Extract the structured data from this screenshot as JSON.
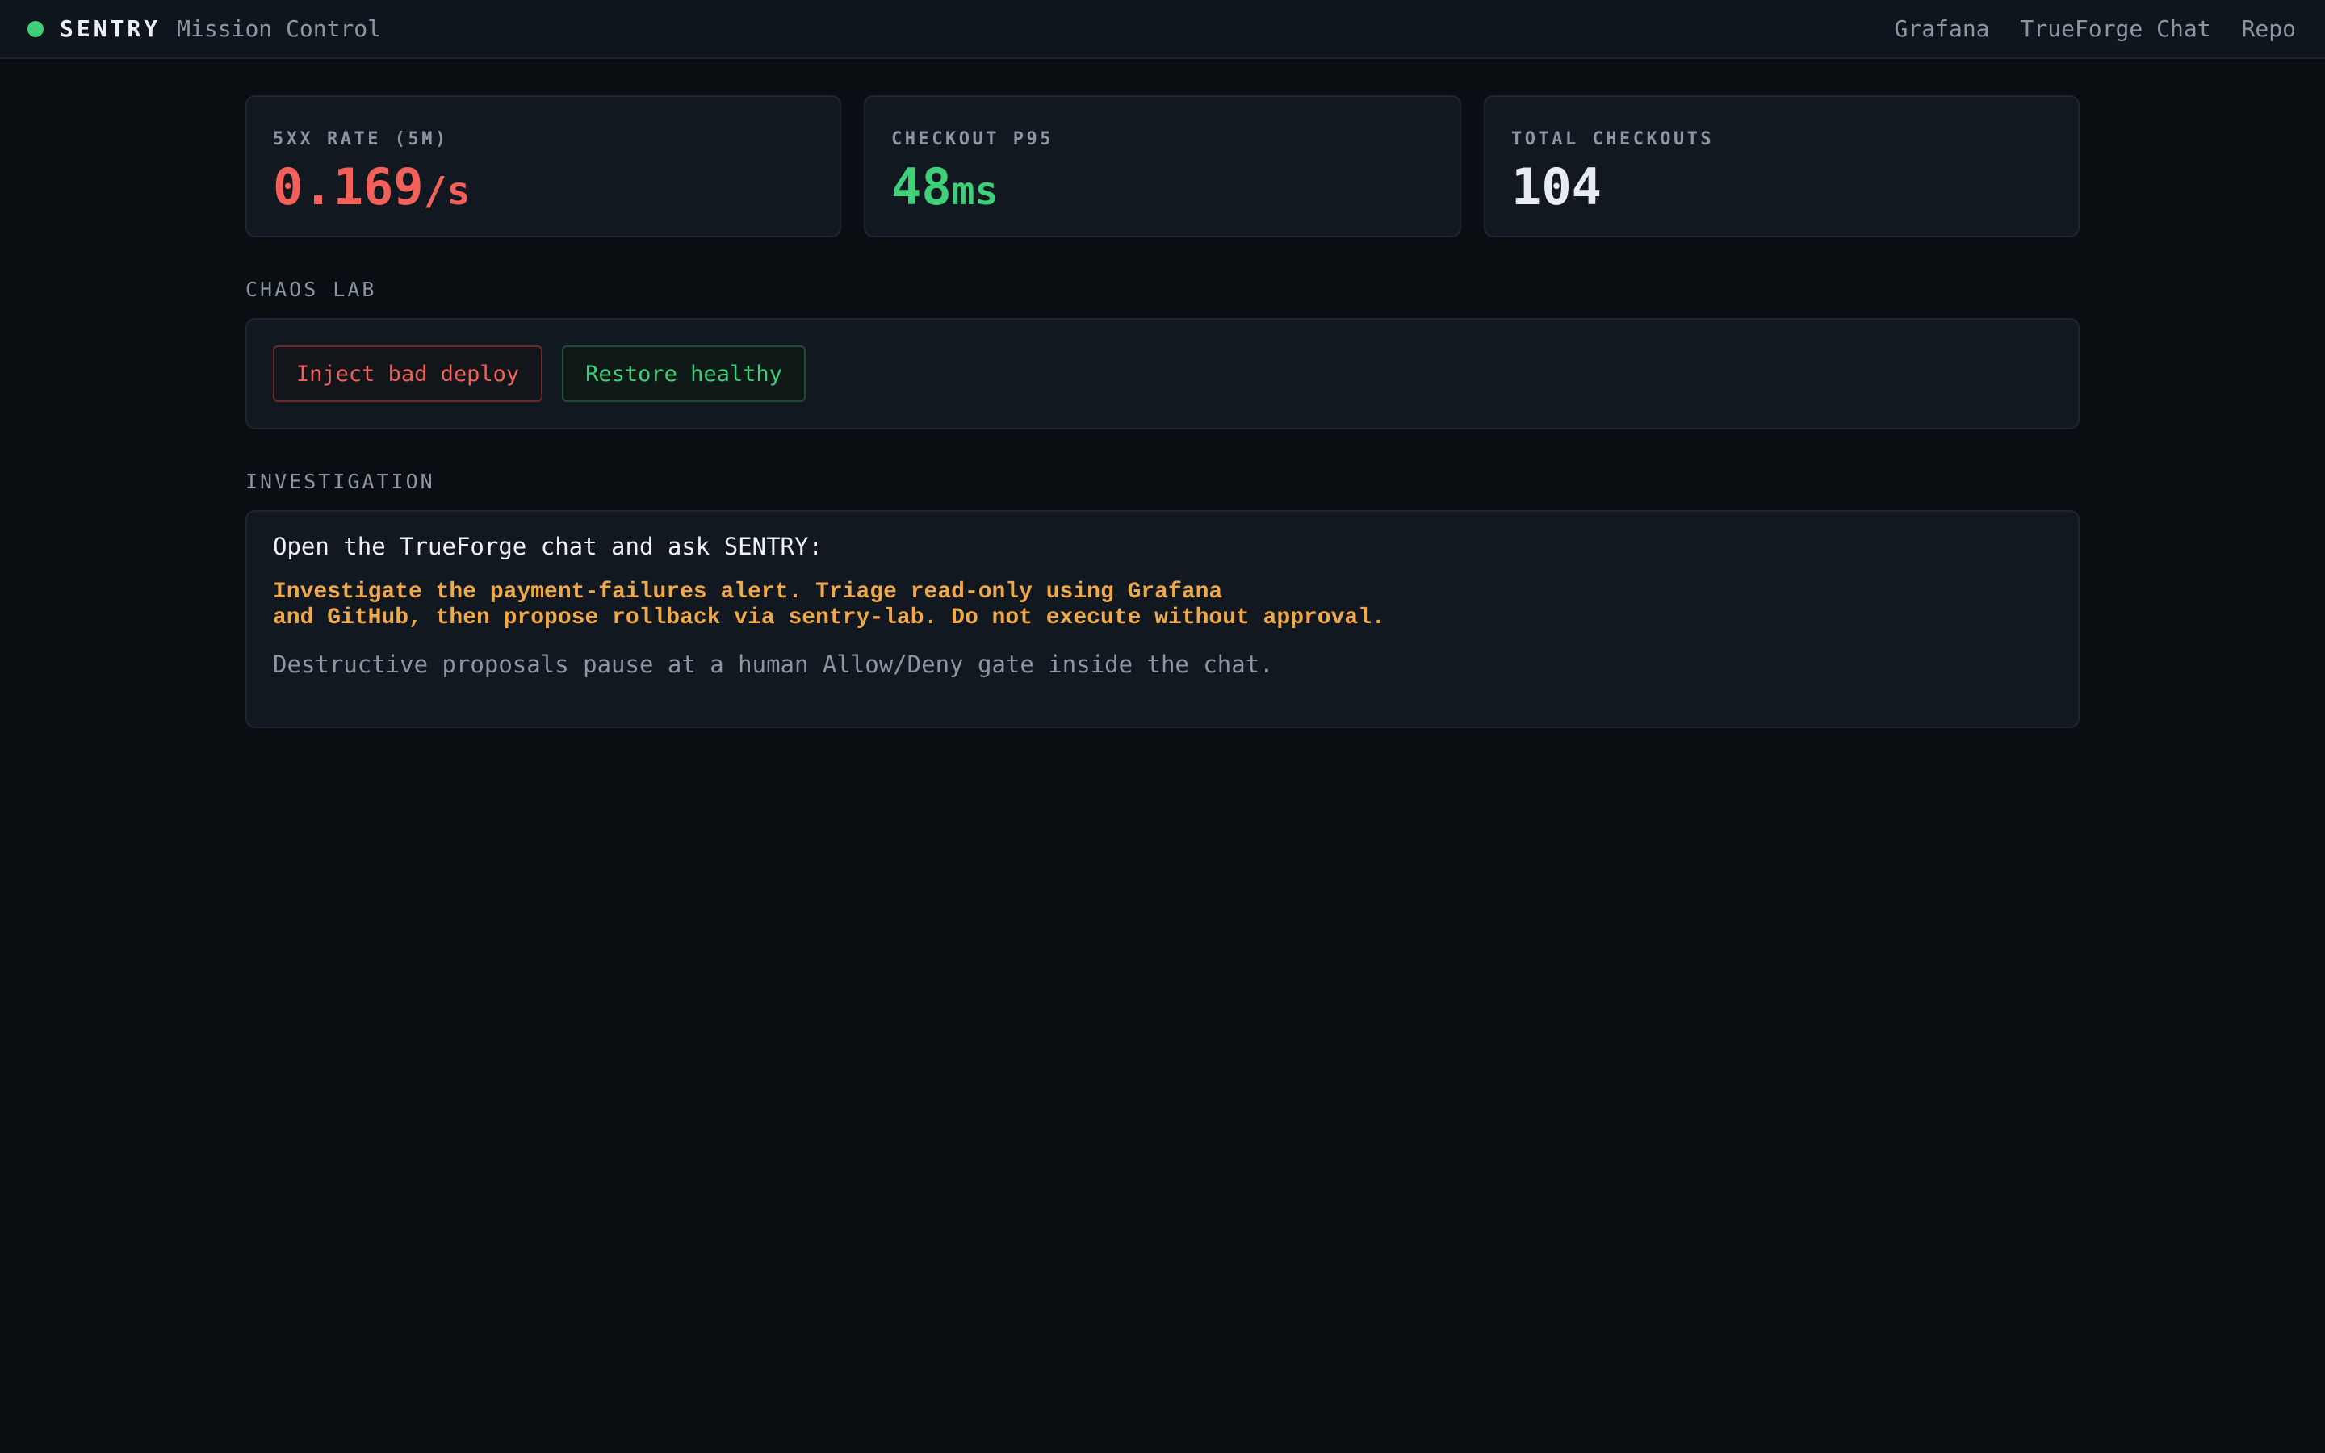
{
  "header": {
    "brand": "SENTRY",
    "subtitle": "Mission Control",
    "status": "online",
    "nav": [
      "Grafana",
      "TrueForge Chat",
      "Repo"
    ]
  },
  "stats": [
    {
      "label": "5XX RATE (5M)",
      "value": "0.169",
      "unit": "/s",
      "color": "#f2605a"
    },
    {
      "label": "CHECKOUT P95",
      "value": "48",
      "unit": "ms",
      "color": "#3ecf78"
    },
    {
      "label": "TOTAL CHECKOUTS",
      "value": "104",
      "unit": "",
      "color": "#e8ecf1"
    }
  ],
  "chaos_lab": {
    "title": "CHAOS LAB",
    "inject_label": "Inject bad deploy",
    "restore_label": "Restore healthy"
  },
  "investigation": {
    "title": "INVESTIGATION",
    "lead": "Open the TrueForge chat and ask SENTRY:",
    "prompt_lines": [
      "Investigate the payment-failures alert. Triage read-only using Grafana",
      "and GitHub, then propose rollback via sentry-lab. Do not execute without approval."
    ],
    "note": "Destructive proposals pause at a human Allow/Deny gate inside the chat."
  },
  "colors": {
    "background": "#0a0d12",
    "panel": "#111820",
    "accent_green": "#3ecf78",
    "accent_red": "#f2605a",
    "prompt_amber": "#f0a94a"
  }
}
